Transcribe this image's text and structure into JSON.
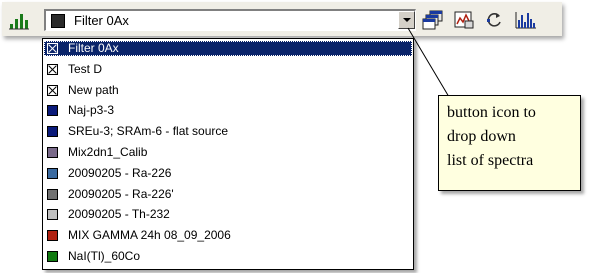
{
  "combo": {
    "selected_label": "Filter 0Ax"
  },
  "icons": {
    "left": "chart-icon",
    "right": [
      "windows-icon",
      "save-spectrum-icon",
      "refresh-icon",
      "spectrum-chart-icon"
    ]
  },
  "dropdown": {
    "items": [
      {
        "label": "Filter 0Ax",
        "swatch": "cross",
        "selected": true
      },
      {
        "label": "Test D",
        "swatch": "cross"
      },
      {
        "label": "New path",
        "swatch": "cross"
      },
      {
        "label": "Naj-p3-3",
        "swatch": "#0a1a7a"
      },
      {
        "label": "SREu-3; SRAm-6 - flat source",
        "swatch": "#0a1a7a"
      },
      {
        "label": "Mix2dn1_Calib",
        "swatch": "#7a6a8a"
      },
      {
        "label": "20090205 - Ra-226",
        "swatch": "#3a6aa0"
      },
      {
        "label": "20090205 - Ra-226'",
        "swatch": "#707070"
      },
      {
        "label": "20090205 - Th-232",
        "swatch": "#c0c0c0"
      },
      {
        "label": "MIX GAMMA 24h 08_09_2006",
        "swatch": "#b02010"
      },
      {
        "label": "NaI(Tl)_60Co",
        "swatch": "#107a10"
      }
    ]
  },
  "callout": {
    "lines": [
      "button icon to",
      "drop down",
      "list of spectra"
    ]
  }
}
